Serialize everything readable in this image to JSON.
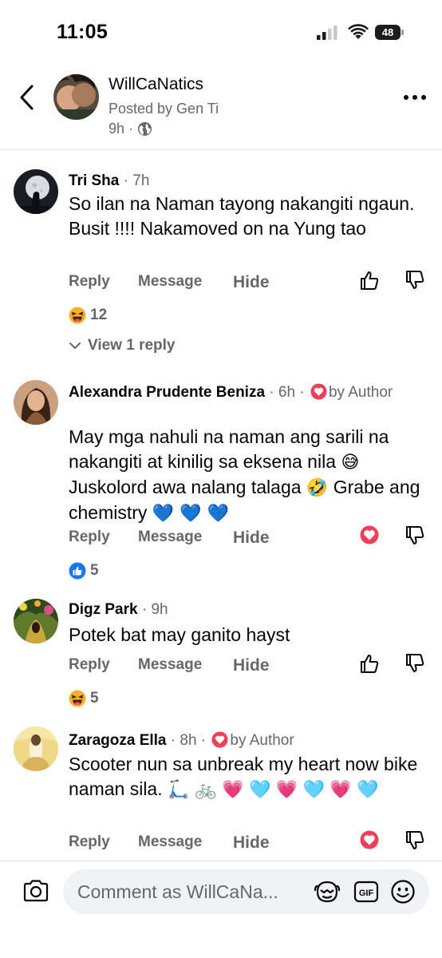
{
  "status_bar": {
    "time": "11:05",
    "battery": "48"
  },
  "post": {
    "group_name": "WillCaNatics",
    "posted_by": "Posted by Gen Ti",
    "age": "9h",
    "separator": "·"
  },
  "comments": [
    {
      "name": "Tri Sha",
      "sep": " · ",
      "time": "7h",
      "text": "So ilan na Naman tayong nakangiti ngaun. Busit !!!! Nakamoved on na Yung tao",
      "reply": "Reply",
      "message": "Message",
      "hide": "Hide",
      "reaction_count": "12",
      "view_replies": "View 1 reply"
    },
    {
      "name": "Alexandra Prudente Beniza",
      "sep": " · ",
      "time": "6h",
      "author_badge": "by Author",
      "text_1": "May mga nahuli na naman ang sarili na nakangiti at kinilig sa eksena nila ",
      "emoji_1": "😅",
      "text_2": " Juskolord awa nalang talaga ",
      "emoji_2": "🤣",
      "text_3": " Grabe ang chemistry ",
      "hearts": "💙 💙 💙",
      "reply": "Reply",
      "message": "Message",
      "hide": "Hide",
      "reaction_count": "5"
    },
    {
      "name": "Digz Park",
      "sep": " · ",
      "time": "9h",
      "text": "Potek bat may ganito hayst",
      "reply": "Reply",
      "message": "Message",
      "hide": "Hide",
      "reaction_count": "5"
    },
    {
      "name": "Zaragoza Ella",
      "sep": " · ",
      "time": "8h",
      "author_badge": "by Author",
      "text": "Scooter nun sa unbreak my heart now bike naman sila. ",
      "emojis": "🛴 🚲",
      "hearts_pink_1": "💗",
      "hearts_cyan_1": "🩵",
      "reply": "Reply",
      "message": "Message",
      "hide": "Hide"
    }
  ],
  "composer": {
    "placeholder": "Comment as WillCaNa..."
  },
  "colors": {
    "text": "#050505",
    "muted": "#65676b",
    "accent": "#1877f2",
    "love": "#f33e58",
    "input_bg": "#f0f2f5"
  },
  "icons": [
    "back-chevron-icon",
    "globe-icon",
    "more-icon",
    "thumbs-up-icon",
    "thumbs-down-icon",
    "laugh-reaction-icon",
    "like-reaction-icon",
    "love-reaction-icon",
    "camera-icon",
    "avatar-sticker-icon",
    "gif-icon",
    "emoji-icon"
  ]
}
